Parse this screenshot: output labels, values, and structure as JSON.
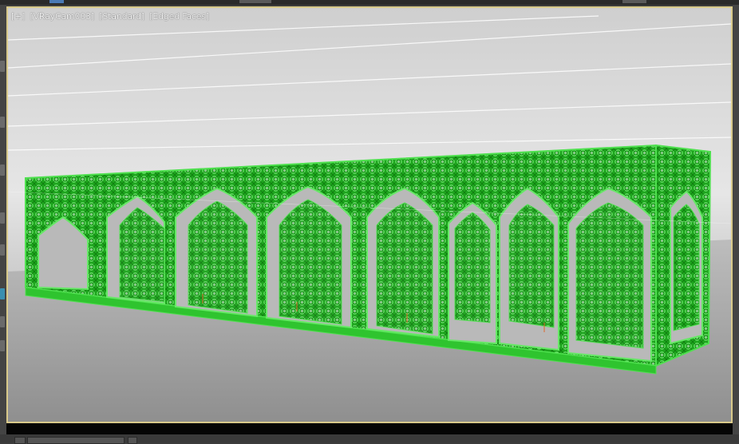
{
  "viewport": {
    "label_parts": [
      "[+]",
      "[VRayCam003]",
      "[Standard]",
      "[Edged Faces]"
    ],
    "colors": {
      "frame_border": "#d8c98a",
      "model_wire": "#22b722",
      "model_edge": "#4fe04f",
      "sky_top": "#c8c8c8",
      "ground": "#a7a7a7"
    },
    "object": "screen-wall-lattice"
  }
}
